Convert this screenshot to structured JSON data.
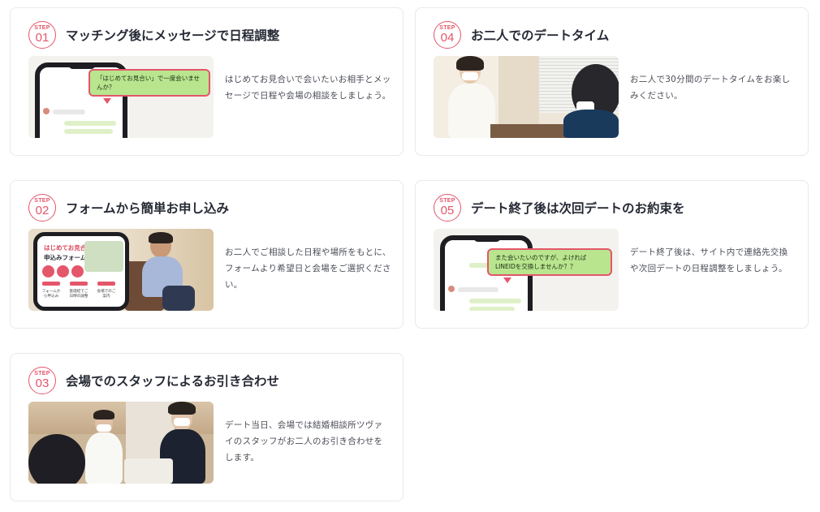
{
  "steps": [
    {
      "step_label": "STEP",
      "number": "01",
      "title": "マッチング後にメッセージで日程調整",
      "description": "はじめてお見合いで会いたいお相手とメッセージで日程や会場の相談をしましょう。",
      "bubble": "「はじめてお見合い」で一度会いませんか？"
    },
    {
      "step_label": "STEP",
      "number": "02",
      "title": "フォームから簡単お申し込み",
      "description": "お二人でご相談した日程や場所をもとに、フォームより希望日と会場をご選択ください。",
      "form_title": "はじめてお見合い",
      "form_subtitle": "申込みフォーム",
      "form_steps": [
        "フォームから申込み",
        "基礎結でご日時の調整",
        "会場でのご案内"
      ]
    },
    {
      "step_label": "STEP",
      "number": "03",
      "title": "会場でのスタッフによるお引き合わせ",
      "description": "デート当日、会場では結婚相談所ツヴァイのスタッフがお二人のお引き合わせをします。"
    },
    {
      "step_label": "STEP",
      "number": "04",
      "title": "お二人でのデートタイム",
      "description": "お二人で30分間のデートタイムをお楽しみください。"
    },
    {
      "step_label": "STEP",
      "number": "05",
      "title": "デート終了後は次回デートのお約束を",
      "description": "デート終了後は、サイト内で連絡先交換や次回デートの日程調整をしましょう。",
      "bubble": "また会いたいのですが、よければLINEIDを交換しませんか？？"
    }
  ],
  "colors": {
    "accent": "#e4566a",
    "bubble_green": "#b8e58e",
    "title": "#262a35",
    "text": "#4a4d56",
    "border": "#e9e9ee"
  }
}
